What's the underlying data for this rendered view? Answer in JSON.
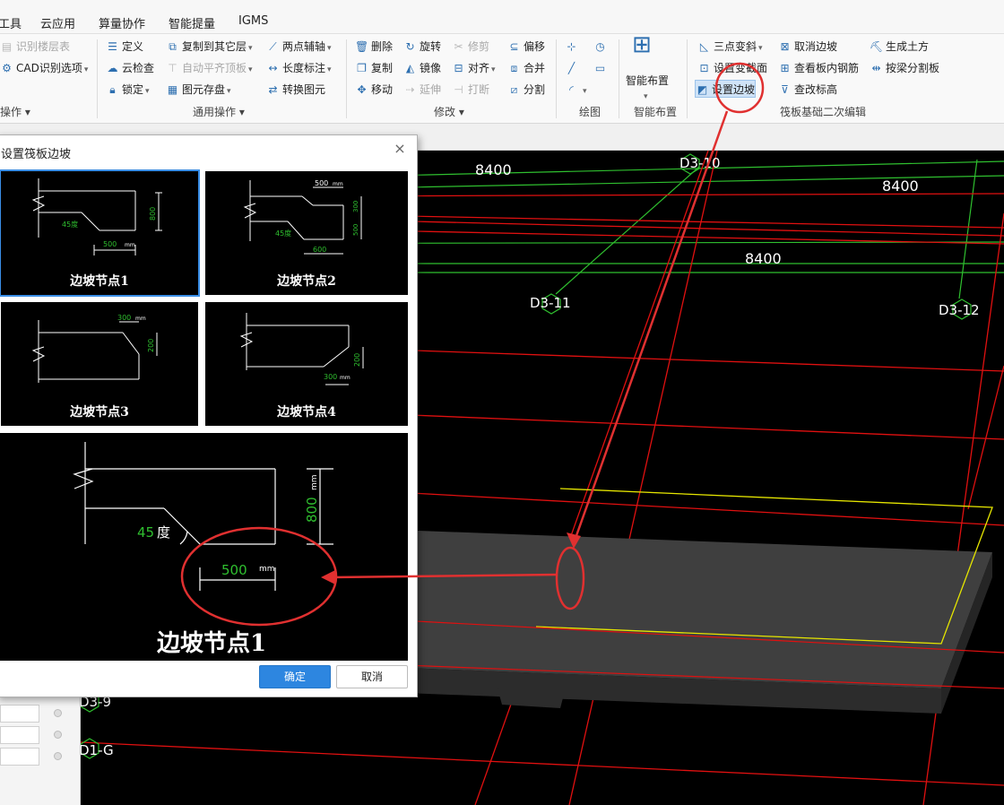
{
  "menu": {
    "items": [
      "工具",
      "云应用",
      "算量协作",
      "智能提量",
      "IGMS"
    ]
  },
  "ribbon": {
    "groups": {
      "operate": "操作",
      "general": "通用操作",
      "modify": "修改",
      "draw": "绘图",
      "smart": "智能布置",
      "raft": "筏板基础二次编辑"
    },
    "operate_items": [
      "识别楼层表",
      "CAD识别选项"
    ],
    "general_items": [
      "定义",
      "云检查",
      "锁定",
      "复制到其它层",
      "自动平齐顶板",
      "图元存盘",
      "两点辅轴",
      "长度标注",
      "转换图元"
    ],
    "modify_items": [
      "删除",
      "复制",
      "移动",
      "旋转",
      "镜像",
      "延伸",
      "修剪",
      "对齐",
      "打断",
      "偏移",
      "合并",
      "分割"
    ],
    "smart_label": "智能布置",
    "raft_items": [
      "三点变斜",
      "设置变截面",
      "设置边坡",
      "取消边坡",
      "查看板内钢筋",
      "查改标高",
      "生成土方",
      "按梁分割板"
    ]
  },
  "canvas": {
    "axis_labels": [
      "D3-10",
      "D3-11",
      "D3-12",
      "D3-9",
      "D1-G"
    ],
    "dimensions": [
      "8400",
      "8400",
      "8400"
    ]
  },
  "dialog": {
    "title": "设置筏板边坡",
    "close": "×",
    "nodes": [
      "边坡节点1",
      "边坡节点2",
      "边坡节点3",
      "边坡节点4"
    ],
    "preview_label": "边坡节点1",
    "preview": {
      "angle": "45",
      "angle_unit": "度",
      "width": "500",
      "width_unit": "mm",
      "height": "800",
      "height_unit": "mm"
    },
    "thumb1": {
      "angle": "45度",
      "width": "500",
      "height": "800",
      "unit": "mm"
    },
    "thumb2": {
      "top": "500",
      "h1": "300",
      "h2": "500",
      "angle": "45度",
      "bottom": "600",
      "unit": "mm"
    },
    "thumb3": {
      "top": "300",
      "height": "200",
      "unit": "mm"
    },
    "thumb4": {
      "height": "200",
      "bottom": "300",
      "unit": "mm"
    },
    "ok": "确定",
    "cancel": "取消"
  },
  "colors": {
    "accent_blue": "#2d86e0",
    "annotation_red": "#e03030",
    "grid_green": "#2fbf2f",
    "axis_red": "#e01010",
    "slab_yellow": "#e6e600"
  }
}
